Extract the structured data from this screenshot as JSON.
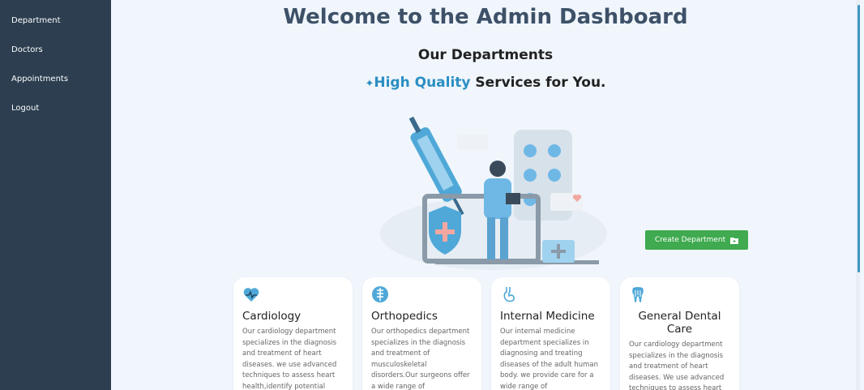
{
  "sidebar": {
    "items": [
      {
        "label": "Department"
      },
      {
        "label": "Doctors"
      },
      {
        "label": "Appointments"
      },
      {
        "label": "Logout"
      }
    ]
  },
  "main": {
    "title": "Welcome to the Admin Dashboard",
    "subtitle": "Our Departments",
    "tagline_highlight": "High Quality",
    "tagline_rest": " Services for You.",
    "create_button": "Create Department",
    "cards": [
      {
        "icon": "heart-pulse-icon",
        "title": "Cardiology",
        "text": "Our cardiology department specializes in the diagnosis and treatment of heart diseases. we use advanced techniques to assess heart health,identify potential"
      },
      {
        "icon": "spine-icon",
        "title": "Orthopedics",
        "text": "Our orthopedics department specializes in the diagnosis and treatment of musculoskeletal disorders.Our surgeons offer a wide range of"
      },
      {
        "icon": "stomach-icon",
        "title": "Internal Medicine",
        "text": "Our internal medicine department specializes in diagnosing and treating diseases of the adult human body. we provide care for a wide range of"
      },
      {
        "icon": "tooth-icon",
        "title": "General Dental Care",
        "text": "Our cardiology department specializes in the diagnosis and treatment of heart diseases. We use advanced techniques to assess heart"
      }
    ]
  },
  "colors": {
    "sidebar": "#2c3e50",
    "accent": "#2b8ec2",
    "button": "#3faa4f",
    "title": "#3d5168"
  }
}
